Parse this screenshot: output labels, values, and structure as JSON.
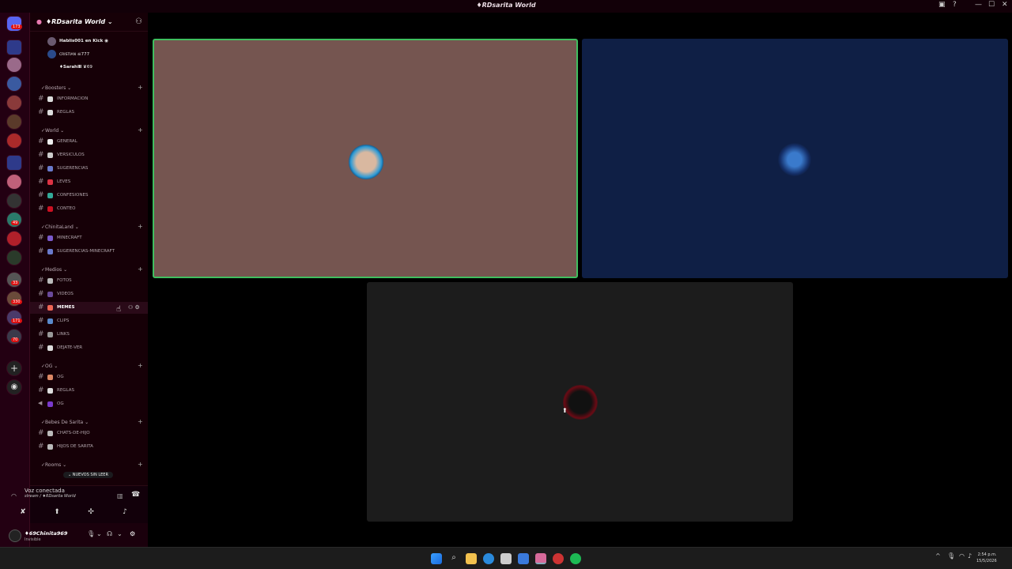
{
  "window": {
    "title": "♦RDsarita World",
    "controls": [
      "▣",
      "?",
      "—",
      "☐",
      "✕"
    ]
  },
  "rail": {
    "top_badge": "173",
    "badges": [
      "49",
      "33",
      "330",
      "171",
      "70"
    ]
  },
  "server": {
    "name": "♦RDsarita World ⌄",
    "invite_icon": "person-add-icon"
  },
  "voice_users": [
    {
      "name": "Hablis001 en Kick ◉",
      "extra": ""
    },
    {
      "name": "CRISTIAN",
      "extra": "☠777"
    },
    {
      "name": "♦SarahⅢ",
      "extra": "♛69"
    }
  ],
  "categories": [
    {
      "label": "✓Boosters ⌄",
      "channels": [
        {
          "label": "INFORMACION"
        },
        {
          "label": "REGLAS"
        }
      ]
    },
    {
      "label": "✓World ⌄",
      "channels": [
        {
          "label": "GENERAL"
        },
        {
          "label": "VERSICULOS"
        },
        {
          "label": "SUGERENCIAS"
        },
        {
          "label": "LEVES"
        },
        {
          "label": "CONFESIONES"
        },
        {
          "label": "CONTEO"
        }
      ]
    },
    {
      "label": "✓ChinitaLand ⌄",
      "channels": [
        {
          "label": "MINECRAFT"
        },
        {
          "label": "SUGERENCIAS-MINECRAFT"
        }
      ]
    },
    {
      "label": "✓Medios ⌄",
      "channels": [
        {
          "label": "FOTOS"
        },
        {
          "label": "VIDEOS"
        },
        {
          "label": "MEMES"
        },
        {
          "label": "CLIPS"
        },
        {
          "label": "LINKS"
        },
        {
          "label": "DEJATE-VER"
        }
      ]
    },
    {
      "label": "✓OG ⌄",
      "channels": [
        {
          "label": "OG"
        },
        {
          "label": "REGLAS"
        },
        {
          "label": "OG"
        }
      ]
    },
    {
      "label": "✓Bebes De Sarita ⌄",
      "channels": [
        {
          "label": "CHATS-DE-HIJO"
        },
        {
          "label": "HIJOS DE SARITA"
        }
      ]
    },
    {
      "label": "✓Rooms ⌄",
      "channels": []
    }
  ],
  "unread_pill": "⌄ NUEVOS SIN LEER",
  "voice": {
    "status": "Voz conectada",
    "channel": "stream / ♦RDsarita World"
  },
  "user": {
    "name": "♦69Chinita969",
    "status": "Invisible"
  },
  "stage": {
    "tiles": [
      {
        "color": "#755550",
        "border": "#3fbf5f",
        "speaking": true
      },
      {
        "color": "#0f1f45",
        "border": "none",
        "speaking": false
      },
      {
        "color": "#1c1c1c",
        "border": "none",
        "speaking": false
      }
    ]
  },
  "clock": {
    "time": "2:54 p.m.",
    "date": "15/5/2026"
  }
}
